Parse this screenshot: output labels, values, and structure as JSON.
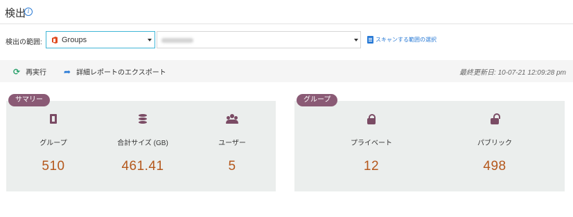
{
  "header": {
    "title": "検出",
    "info_icon": "info-icon"
  },
  "scope": {
    "label": "検出の範囲:",
    "selected": "Groups",
    "selected_icon": "office-icon",
    "second_select_value": "",
    "scan_link": "スキャンする範囲の選択"
  },
  "toolbar": {
    "refresh_label": "再実行",
    "export_label": "詳細レポートのエクスポート",
    "last_updated_label": "最終更新日:",
    "last_updated_value": "10-07-21 12:09:28 pm"
  },
  "summary": {
    "tag": "サマリー",
    "stats": [
      {
        "label": "グループ",
        "value": "510",
        "icon": "office-icon"
      },
      {
        "label": "合計サイズ (GB)",
        "value": "461.41",
        "icon": "database-icon"
      },
      {
        "label": "ユーザー",
        "value": "5",
        "icon": "users-icon"
      }
    ]
  },
  "groups": {
    "tag": "グループ",
    "stats": [
      {
        "label": "プライベート",
        "value": "12",
        "icon": "lock-icon"
      },
      {
        "label": "パブリック",
        "value": "498",
        "icon": "unlock-icon"
      }
    ]
  },
  "colors": {
    "accent": "#8a5a75",
    "value": "#b4571b",
    "link": "#2a7bd6",
    "select_border": "#3fb5d6"
  }
}
